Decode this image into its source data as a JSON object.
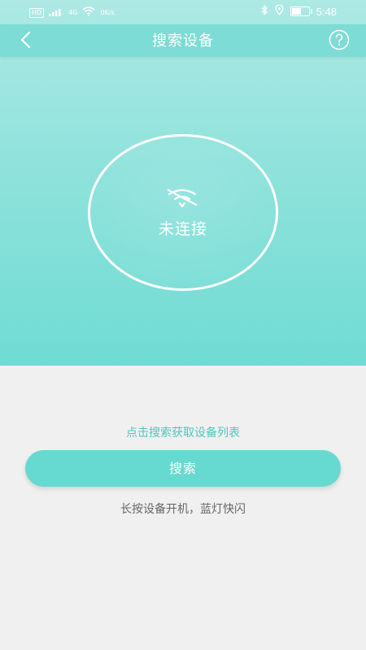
{
  "status_bar": {
    "network_badge": "HD",
    "signal_label": "4G",
    "speed": "0K/s",
    "time": "5:48",
    "battery_level": 0.6
  },
  "header": {
    "title": "搜索设备",
    "back_icon": "chevron-left-icon",
    "help_icon": "question-circle-icon"
  },
  "connection": {
    "status": "未连接",
    "icon": "wifi-off-icon"
  },
  "actions": {
    "hint_top": "点击搜索获取设备列表",
    "search_label": "搜索",
    "hint_bottom": "长按设备开机，蓝灯快闪"
  },
  "colors": {
    "accent": "#66d9d0",
    "hero_top": "#aee9e4",
    "hero_bottom": "#6fdcd3",
    "hint_text": "#4cc7bd",
    "background": "#f0f0f0"
  }
}
